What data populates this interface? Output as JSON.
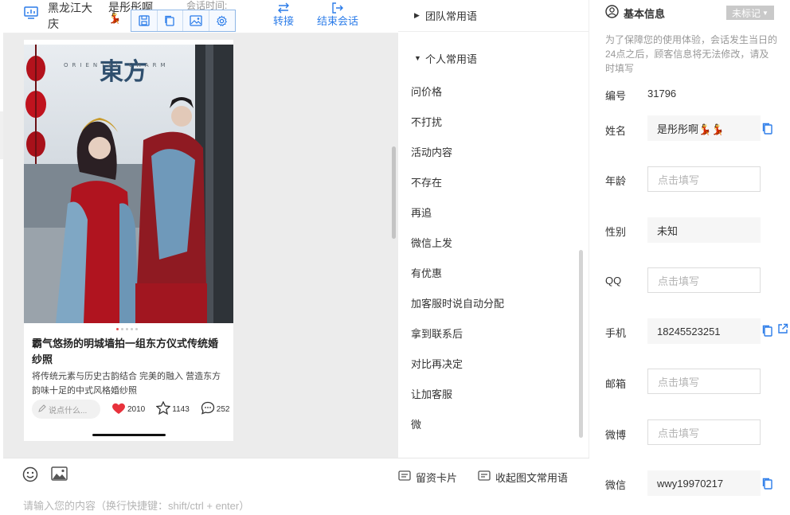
{
  "chat_header": {
    "region": "黑龙江大庆",
    "customer_name": "是彤彤啊",
    "name_emoji": "💃",
    "session_time_label": "会话时间:",
    "transfer_label": "转接",
    "end_session_label": "结束会话"
  },
  "card": {
    "title": "霸气悠扬的明城墙拍一组东方仪式传统婚纱照",
    "description": "将传统元素与历史古韵结合 完美的融入 营造东方韵味十足的中式风格婚纱照",
    "comment_placeholder": "说点什么...",
    "likes": "2010",
    "favorites": "1143",
    "comments": "252",
    "brand_text": "東方",
    "brand_subtext": "ORIENTAL CHARM"
  },
  "phrases": {
    "team_group_label": "团队常用语",
    "personal_group_label": "个人常用语",
    "items": [
      "问价格",
      "不打扰",
      "活动内容",
      "不存在",
      "再追",
      "微信上发",
      "有优惠",
      "加客服时说自动分配",
      "拿到联系后",
      "对比再决定",
      "让加客服",
      "微"
    ]
  },
  "input": {
    "placeholder": "请输入您的内容（换行快捷键：shift/ctrl + enter）",
    "leave_card_label": "留资卡片",
    "collapse_label": "收起图文常用语"
  },
  "info": {
    "title": "基本信息",
    "tag": "未标记",
    "notice": "为了保障您的使用体验，会话发生当日的24点之后，顾客信息将无法修改，请及时填写",
    "id_label": "编号",
    "id_value": "31796",
    "name_label": "姓名",
    "name_value": "是彤彤啊💃💃",
    "age_label": "年龄",
    "gender_label": "性别",
    "gender_value": "未知",
    "qq_label": "QQ",
    "phone_label": "手机",
    "phone_value": "18245523251",
    "email_label": "邮箱",
    "weibo_label": "微博",
    "wechat_label": "微信",
    "wechat_value": "wwy19970217",
    "empty_placeholder": "点击填写"
  },
  "colors": {
    "accent": "#2b7ce9",
    "like_red": "#e8323c",
    "tag_gray": "#c9c9c9"
  }
}
